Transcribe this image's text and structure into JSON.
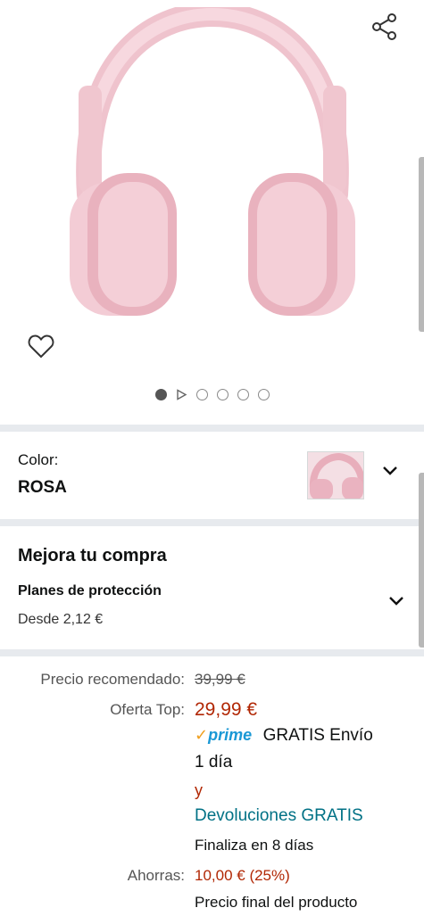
{
  "gallery": {
    "icons": {
      "share": "share-icon",
      "wishlist": "heart-icon",
      "play": "play-icon"
    },
    "image_count": 6,
    "active_index": 0
  },
  "variant": {
    "label": "Color:",
    "value": "ROSA"
  },
  "upsell": {
    "title": "Mejora tu compra",
    "plans_title": "Planes de protección",
    "plans_from": "Desde 2,12 €"
  },
  "pricing": {
    "recommended_label": "Precio recomendado:",
    "recommended_price": "39,99 €",
    "offer_label": "Oferta Top:",
    "offer_price": "29,99 €",
    "prime_label": "prime",
    "shipping_line1": "GRATIS Envío",
    "shipping_line2": "1 día",
    "and": "y",
    "returns_link": "Devoluciones GRATIS",
    "ends_in": "Finaliza en 8 días",
    "savings_label": "Ahorras:",
    "savings_value": "10,00 € (25%)",
    "final_price_note": "Precio final del producto"
  },
  "colors": {
    "price_red": "#b12704",
    "link_teal": "#007185",
    "prime_blue": "#1a98d5",
    "product_pink": "#f2c4cf"
  }
}
